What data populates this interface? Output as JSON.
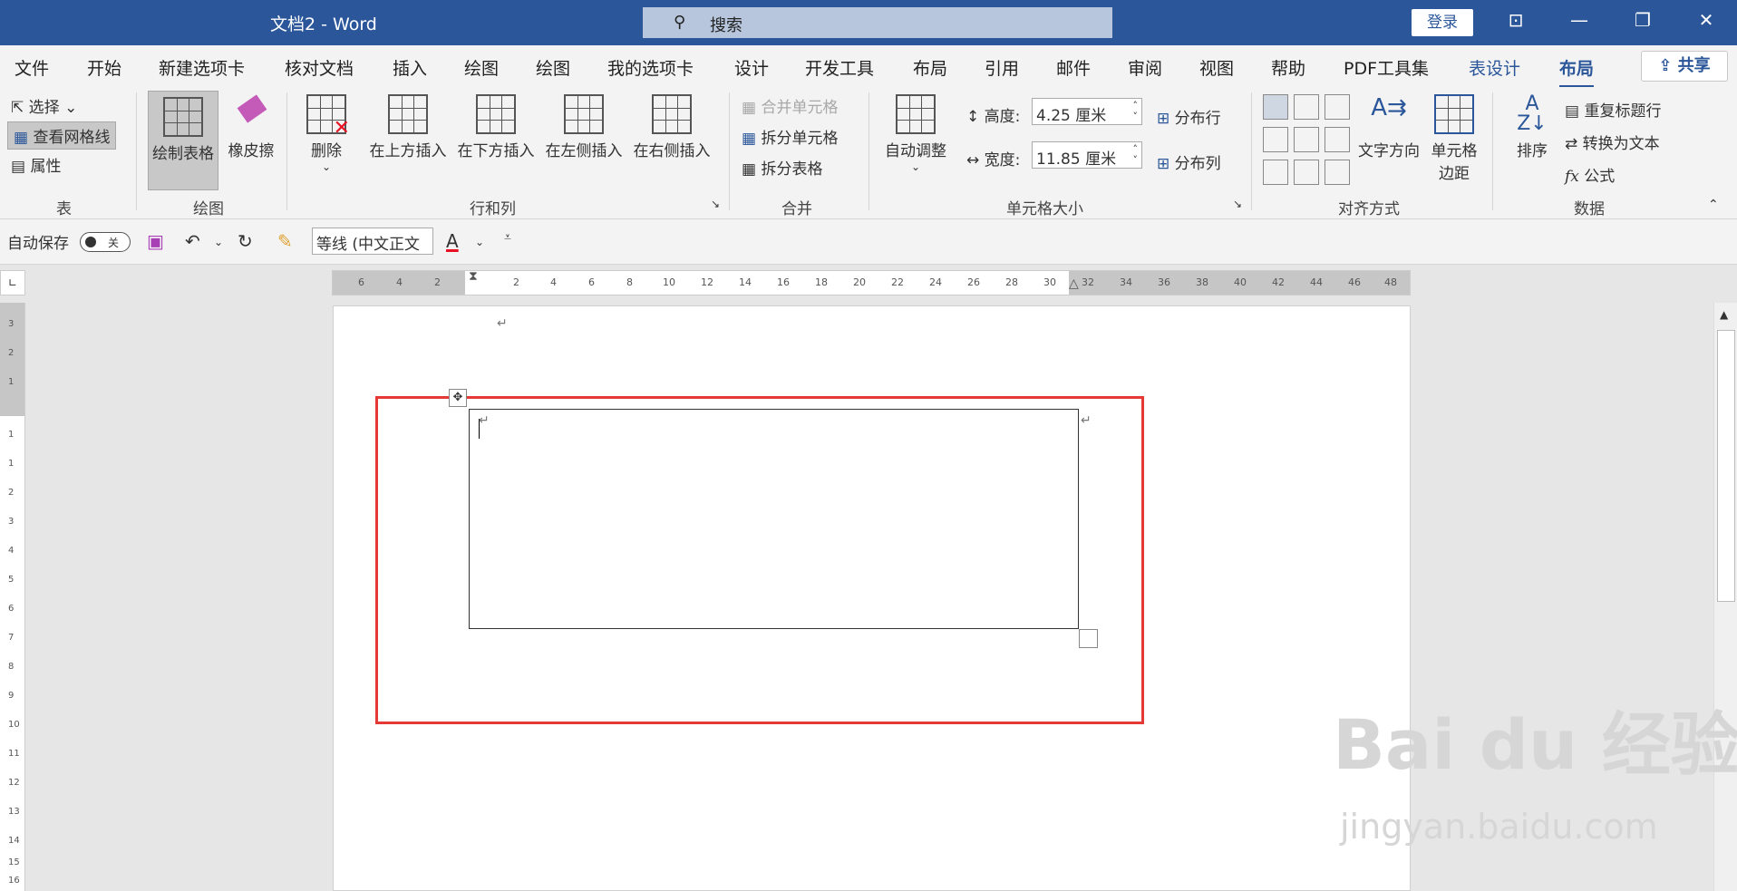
{
  "titlebar": {
    "title": "文档2 - Word",
    "search_placeholder": "搜索",
    "login_label": "登录",
    "window_controls": [
      "ribbon-display-icon",
      "minimize-icon",
      "restore-icon",
      "close-icon"
    ]
  },
  "tabs": [
    {
      "label": "文件"
    },
    {
      "label": "开始"
    },
    {
      "label": "新建选项卡"
    },
    {
      "label": "核对文档"
    },
    {
      "label": "插入"
    },
    {
      "label": "绘图"
    },
    {
      "label": "绘图"
    },
    {
      "label": "我的选项卡"
    },
    {
      "label": "设计"
    },
    {
      "label": "开发工具"
    },
    {
      "label": "布局"
    },
    {
      "label": "引用"
    },
    {
      "label": "邮件"
    },
    {
      "label": "审阅"
    },
    {
      "label": "视图"
    },
    {
      "label": "帮助"
    },
    {
      "label": "PDF工具集"
    },
    {
      "label": "表设计"
    },
    {
      "label": "布局"
    }
  ],
  "share_label": "共享",
  "ribbon": {
    "table_group": {
      "select": "选择",
      "view_gridlines": "查看网格线",
      "properties": "属性",
      "label": "表"
    },
    "draw_group": {
      "draw_table": "绘制表格",
      "eraser": "橡皮擦",
      "label": "绘图"
    },
    "rows_cols_group": {
      "delete": "删除",
      "insert_above": "在上方插入",
      "insert_below": "在下方插入",
      "insert_left": "在左侧插入",
      "insert_right": "在右侧插入",
      "label": "行和列"
    },
    "merge_group": {
      "merge_cells": "合并单元格",
      "split_cells": "拆分单元格",
      "split_table": "拆分表格",
      "label": "合并"
    },
    "cell_size_group": {
      "autofit": "自动调整",
      "height_label": "高度:",
      "height_value": "4.25 厘米",
      "width_label": "宽度:",
      "width_value": "11.85 厘米",
      "distribute_rows": "分布行",
      "distribute_cols": "分布列",
      "label": "单元格大小"
    },
    "alignment_group": {
      "text_direction": "文字方向",
      "cell_margins_line1": "单元格",
      "cell_margins_line2": "边距",
      "label": "对齐方式"
    },
    "data_group": {
      "sort": "排序",
      "repeat_header": "重复标题行",
      "convert_to_text": "转换为文本",
      "formula": "公式",
      "label": "数据"
    }
  },
  "qat": {
    "autosave_label": "自动保存",
    "autosave_state": "关",
    "font_name": "等线 (中文正文",
    "font_color_letter": "A",
    "font_color": "#e81123"
  },
  "ruler": {
    "h_ticks": [
      "6",
      "4",
      "2",
      "2",
      "4",
      "6",
      "8",
      "10",
      "12",
      "14",
      "16",
      "18",
      "20",
      "22",
      "24",
      "26",
      "28",
      "30",
      "32",
      "34",
      "36",
      "38",
      "40",
      "42",
      "44",
      "46",
      "48"
    ],
    "v_ticks": [
      "3",
      "2",
      "1",
      "1",
      "1",
      "2",
      "3",
      "4",
      "5",
      "6",
      "7",
      "8",
      "9",
      "10",
      "11",
      "12",
      "13",
      "14",
      "15",
      "16"
    ]
  },
  "document": {
    "paragraph_mark": "↵"
  },
  "watermark": {
    "text": "Bai du 经验",
    "url": "jingyan.baidu.com"
  },
  "colors": {
    "title_bar": "#2b579a",
    "accent": "#2b579a",
    "highlight_box": "#e53935"
  }
}
